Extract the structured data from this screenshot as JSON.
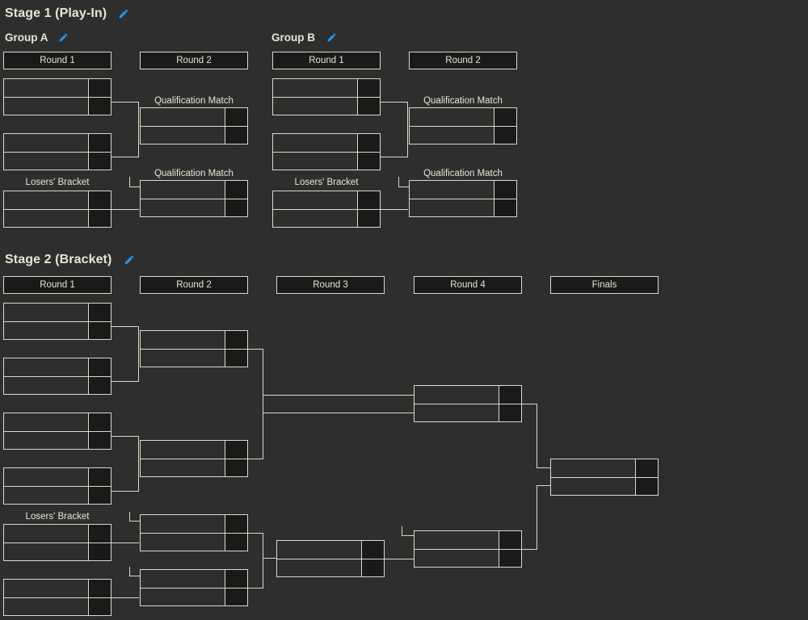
{
  "page": {
    "background_color": "#2e2e2e",
    "line_color": "#ddd9c6",
    "text_color": "#e8e5d5",
    "score_cell_color": "#1a1a1a",
    "accent_color": "#2196f3"
  },
  "stages": [
    {
      "id": "stage-1",
      "title": "Stage 1 (Play-In)",
      "edit_icon": "pencil-icon",
      "groups": [
        {
          "id": "group-a",
          "title": "Group A",
          "edit_icon": "pencil-icon",
          "rounds": [
            {
              "label": "Round 1"
            },
            {
              "label": "Round 2"
            }
          ],
          "labels": [
            {
              "text": "Qualification Match"
            },
            {
              "text": "Losers' Bracket"
            },
            {
              "text": "Qualification Match"
            }
          ],
          "matches": [
            {
              "id": "ga-r1-m1",
              "team_top": "",
              "team_bottom": "",
              "score_top": "",
              "score_bottom": ""
            },
            {
              "id": "ga-r1-m2",
              "team_top": "",
              "team_bottom": "",
              "score_top": "",
              "score_bottom": ""
            },
            {
              "id": "ga-lb-m1",
              "team_top": "",
              "team_bottom": "",
              "score_top": "",
              "score_bottom": ""
            },
            {
              "id": "ga-r2-q1",
              "team_top": "",
              "team_bottom": "",
              "score_top": "",
              "score_bottom": ""
            },
            {
              "id": "ga-r2-q2",
              "team_top": "",
              "team_bottom": "",
              "score_top": "",
              "score_bottom": ""
            }
          ]
        },
        {
          "id": "group-b",
          "title": "Group B",
          "edit_icon": "pencil-icon",
          "rounds": [
            {
              "label": "Round 1"
            },
            {
              "label": "Round 2"
            }
          ],
          "labels": [
            {
              "text": "Qualification Match"
            },
            {
              "text": "Losers' Bracket"
            },
            {
              "text": "Qualification Match"
            }
          ],
          "matches": [
            {
              "id": "gb-r1-m1",
              "team_top": "",
              "team_bottom": "",
              "score_top": "",
              "score_bottom": ""
            },
            {
              "id": "gb-r1-m2",
              "team_top": "",
              "team_bottom": "",
              "score_top": "",
              "score_bottom": ""
            },
            {
              "id": "gb-lb-m1",
              "team_top": "",
              "team_bottom": "",
              "score_top": "",
              "score_bottom": ""
            },
            {
              "id": "gb-r2-q1",
              "team_top": "",
              "team_bottom": "",
              "score_top": "",
              "score_bottom": ""
            },
            {
              "id": "gb-r2-q2",
              "team_top": "",
              "team_bottom": "",
              "score_top": "",
              "score_bottom": ""
            }
          ]
        }
      ]
    },
    {
      "id": "stage-2",
      "title": "Stage 2 (Bracket)",
      "edit_icon": "pencil-icon",
      "rounds": [
        {
          "label": "Round 1"
        },
        {
          "label": "Round 2"
        },
        {
          "label": "Round 3"
        },
        {
          "label": "Round 4"
        },
        {
          "label": "Finals"
        }
      ],
      "labels": [
        {
          "text": "Losers' Bracket"
        }
      ],
      "matches": [
        {
          "id": "s2-r1-m1",
          "team_top": "",
          "team_bottom": "",
          "score_top": "",
          "score_bottom": ""
        },
        {
          "id": "s2-r1-m2",
          "team_top": "",
          "team_bottom": "",
          "score_top": "",
          "score_bottom": ""
        },
        {
          "id": "s2-r1-m3",
          "team_top": "",
          "team_bottom": "",
          "score_top": "",
          "score_bottom": ""
        },
        {
          "id": "s2-r1-m4",
          "team_top": "",
          "team_bottom": "",
          "score_top": "",
          "score_bottom": ""
        },
        {
          "id": "s2-r1-lb1",
          "team_top": "",
          "team_bottom": "",
          "score_top": "",
          "score_bottom": ""
        },
        {
          "id": "s2-r1-lb2",
          "team_top": "",
          "team_bottom": "",
          "score_top": "",
          "score_bottom": ""
        },
        {
          "id": "s2-r2-m1",
          "team_top": "",
          "team_bottom": "",
          "score_top": "",
          "score_bottom": ""
        },
        {
          "id": "s2-r2-m2",
          "team_top": "",
          "team_bottom": "",
          "score_top": "",
          "score_bottom": ""
        },
        {
          "id": "s2-r2-m3",
          "team_top": "",
          "team_bottom": "",
          "score_top": "",
          "score_bottom": ""
        },
        {
          "id": "s2-r2-m4",
          "team_top": "",
          "team_bottom": "",
          "score_top": "",
          "score_bottom": ""
        },
        {
          "id": "s2-r3-m1",
          "team_top": "",
          "team_bottom": "",
          "score_top": "",
          "score_bottom": ""
        },
        {
          "id": "s2-r4-m1",
          "team_top": "",
          "team_bottom": "",
          "score_top": "",
          "score_bottom": ""
        },
        {
          "id": "s2-r4-m2",
          "team_top": "",
          "team_bottom": "",
          "score_top": "",
          "score_bottom": ""
        },
        {
          "id": "s2-finals-m1",
          "team_top": "",
          "team_bottom": "",
          "score_top": "",
          "score_bottom": ""
        }
      ]
    }
  ]
}
